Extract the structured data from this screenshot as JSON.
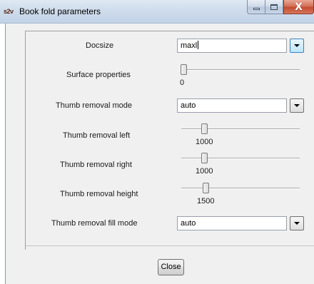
{
  "window": {
    "app_icon_text": "s2v",
    "title": "Book fold parameters",
    "close_glyph": "X"
  },
  "form": {
    "docsize": {
      "label": "Docsize",
      "value": "maxl"
    },
    "surface_properties": {
      "label": "Surface properties",
      "value": "0",
      "level": 0
    },
    "thumb_removal_mode": {
      "label": "Thumb removal mode",
      "value": "auto"
    },
    "thumb_removal_left": {
      "label": "Thumb removal left",
      "value": "1000"
    },
    "thumb_removal_right": {
      "label": "Thumb removal right",
      "value": "1000"
    },
    "thumb_removal_height": {
      "label": "Thumb removal height",
      "value": "1500"
    },
    "thumb_removal_fill_mode": {
      "label": "Thumb removal fill mode",
      "value": "auto"
    }
  },
  "footer": {
    "close_label": "Close"
  },
  "colors": {
    "titlebar": "#cfdceb",
    "client_background": "#f0f0f0",
    "close_button_red": "#c14b2f",
    "active_dropdown": "#bee6fd"
  },
  "icons": {
    "app": "app-icon",
    "minimize": "minimize-icon",
    "maximize": "maximize-icon",
    "close": "close-icon",
    "dropdown": "chevron-down-icon"
  }
}
